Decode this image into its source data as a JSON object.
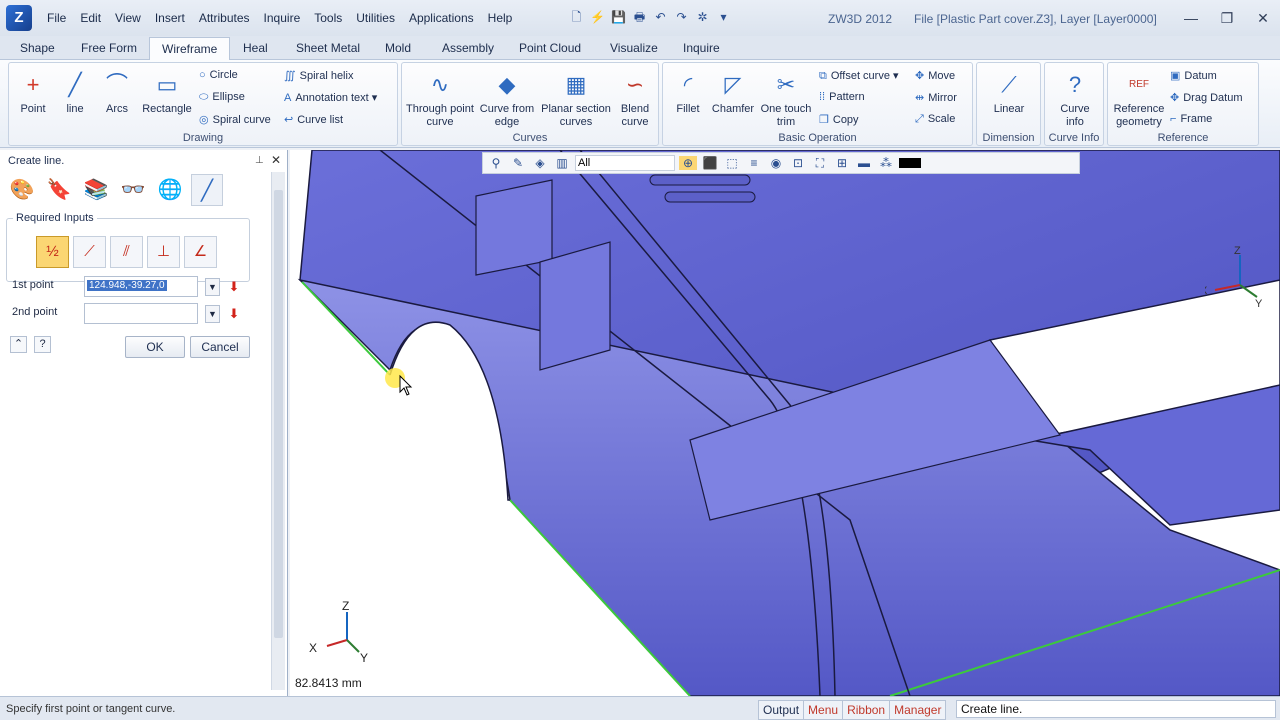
{
  "app": {
    "name": "ZW3D 2012",
    "file_title": "File [Plastic Part cover.Z3],  Layer [Layer0000]"
  },
  "menu": [
    "File",
    "Edit",
    "View",
    "Insert",
    "Attributes",
    "Inquire",
    "Tools",
    "Utilities",
    "Applications",
    "Help"
  ],
  "tabs": [
    "Shape",
    "Free Form",
    "Wireframe",
    "Heal",
    "Sheet Metal",
    "Mold",
    "Assembly",
    "Point Cloud",
    "Visualize",
    "Inquire"
  ],
  "ribbon": {
    "drawing": {
      "label": "Drawing",
      "point": "Point",
      "line": "line",
      "arcs": "Arcs",
      "rectangle": "Rectangle",
      "circle": "Circle",
      "ellipse": "Ellipse",
      "spiral_curve": "Spiral curve",
      "spiral_helix": "Spiral helix",
      "annotation_text": "Annotation text",
      "curve_list": "Curve list"
    },
    "curves": {
      "label": "Curves",
      "through": "Through point curve",
      "from_edge": "Curve from edge",
      "planar": "Planar section curves",
      "blend": "Blend curve"
    },
    "basic": {
      "label": "Basic Operation",
      "fillet": "Fillet",
      "chamfer": "Chamfer",
      "one_touch": "One touch trim",
      "offset": "Offset curve",
      "pattern": "Pattern",
      "copy": "Copy",
      "move": "Move",
      "mirror": "Mirror",
      "scale": "Scale"
    },
    "dimension": {
      "label": "Dimension",
      "linear": "Linear"
    },
    "curve_info": {
      "label": "Curve Info",
      "info": "Curve info"
    },
    "reference": {
      "label": "Reference",
      "ref_geom": "Reference geometry",
      "ref_tag": "REF",
      "datum": "Datum",
      "drag_datum": "Drag Datum",
      "frame": "Frame"
    }
  },
  "panel": {
    "title": "Create line.",
    "required_inputs": "Required Inputs",
    "first_point_label": "1st point",
    "first_point_value": "124.948,-39.27,0",
    "second_point_label": "2nd point",
    "second_point_value": "",
    "ok": "OK",
    "cancel": "Cancel"
  },
  "viewport": {
    "filter": "All",
    "measure": "82.8413 mm",
    "axes": {
      "z": "Z",
      "x": "X",
      "y": "Y"
    }
  },
  "status": {
    "prompt": "Specify first point or tangent curve.",
    "tabs": [
      "Output",
      "Menu",
      "Ribbon",
      "Manager"
    ],
    "command": "Create line."
  }
}
